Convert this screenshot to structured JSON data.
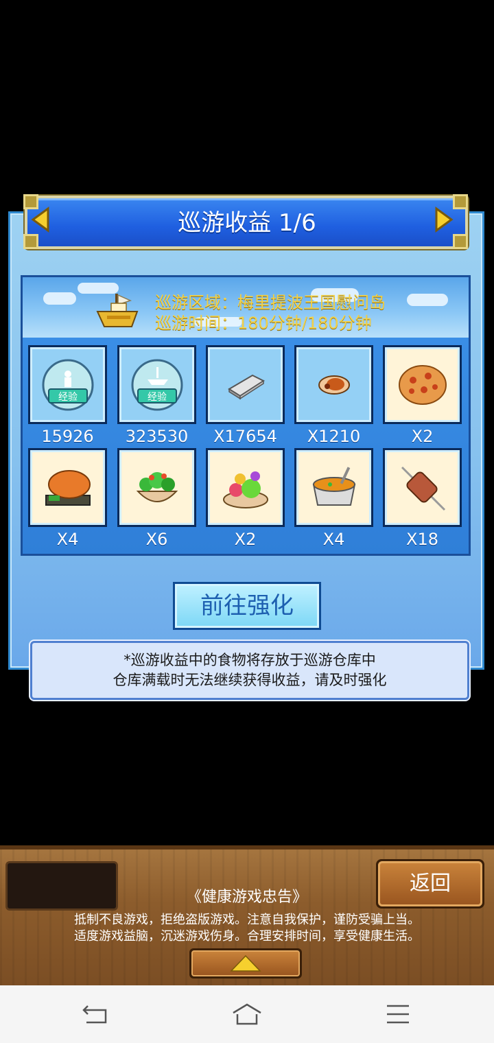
{
  "title": {
    "label": "巡游收益",
    "page": "1/6"
  },
  "region": {
    "area_line": "巡游区域：梅里提波王国慰问岛",
    "time_line": "巡游时间：180分钟/180分钟"
  },
  "items": [
    {
      "icon": "exp-orb-person-icon",
      "count": "15926"
    },
    {
      "icon": "exp-orb-ship-icon",
      "count": "323530"
    },
    {
      "icon": "silver-bar-icon",
      "count": "X17654"
    },
    {
      "icon": "roast-meat-icon",
      "count": "X1210"
    },
    {
      "icon": "pizza-icon",
      "count": "X2"
    },
    {
      "icon": "grilled-fish-icon",
      "count": "X4"
    },
    {
      "icon": "salad-icon",
      "count": "X6"
    },
    {
      "icon": "fruit-platter-icon",
      "count": "X2"
    },
    {
      "icon": "soup-icon",
      "count": "X4"
    },
    {
      "icon": "meat-skewer-icon",
      "count": "X18"
    }
  ],
  "upgrade_button": "前往强化",
  "note": {
    "line1": "*巡游收益中的食物将存放于巡游仓库中",
    "line2": "仓库满载时无法继续获得收益，请及时强化"
  },
  "bottom_bar": {
    "back_label": "返回",
    "health_title": "《健康游戏忠告》",
    "health_line1": "抵制不良游戏，拒绝盗版游戏。注意自我保护，谨防受骗上当。",
    "health_line2": "适度游戏益脑，沉迷游戏伤身。合理安排时间，享受健康生活。"
  },
  "colors": {
    "title_bar": "#1f5fe0",
    "region_text": "#f2d24a",
    "panel": "#86c1ee",
    "wood": "#8c5c2c"
  }
}
